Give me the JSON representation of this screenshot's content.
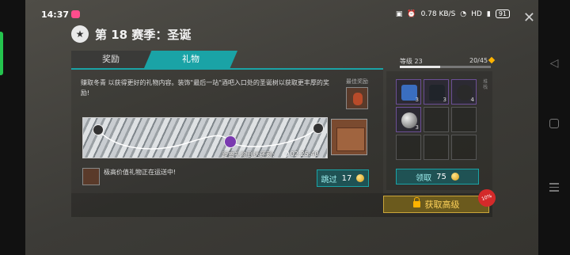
{
  "status_bar": {
    "time": "14:37",
    "net_speed": "0.78 KB/S",
    "hd": "HD",
    "battery": "91"
  },
  "header": {
    "season_title": "第 18 赛季：圣诞",
    "side_label": "圣诞"
  },
  "tabs": [
    {
      "label": "奖励"
    },
    {
      "label": "礼物"
    }
  ],
  "main": {
    "description": "赚取冬青  以获得更好的礼物内容。装饰\"最后一站\"酒吧入口处的圣诞树以获取更丰厚的奖励!",
    "best_reward_label": "最佳奖励",
    "delivery_caption": "距离礼物到达还剩:",
    "delivery_timer": "02:25:40",
    "transit_text": "极高价值礼物正在运送中!",
    "skip": {
      "label": "跳过",
      "cost": "17"
    }
  },
  "level": {
    "label": "等级 23",
    "progress_text": "20/45",
    "progress_fraction": 0.44
  },
  "inventory": {
    "items": [
      {
        "icon": "tank-icon",
        "qty": "3"
      },
      {
        "icon": "vest-icon",
        "qty": "3"
      },
      {
        "icon": "rock-icon",
        "qty": "4"
      },
      {
        "icon": "orb-icon",
        "qty": "3"
      }
    ],
    "side_label": "堆栈"
  },
  "claim": {
    "label": "领取",
    "cost": "75"
  },
  "premium": {
    "label": "获取高级",
    "badge": "10%"
  }
}
